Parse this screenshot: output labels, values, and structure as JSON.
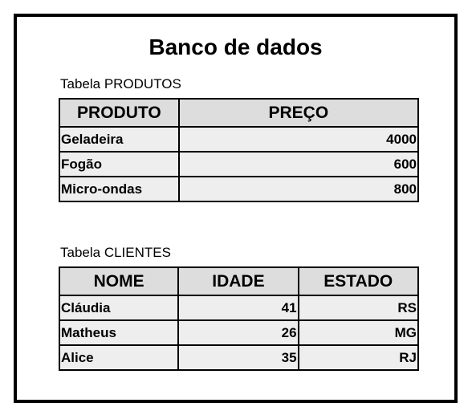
{
  "title": "Banco de dados",
  "produtos": {
    "caption": "Tabela PRODUTOS",
    "headers": [
      "PRODUTO",
      "PREÇO"
    ],
    "rows": [
      {
        "produto": "Geladeira",
        "preco": "4000"
      },
      {
        "produto": "Fogão",
        "preco": "600"
      },
      {
        "produto": "Micro-ondas",
        "preco": "800"
      }
    ]
  },
  "clientes": {
    "caption": "Tabela CLIENTES",
    "headers": [
      "NOME",
      "IDADE",
      "ESTADO"
    ],
    "rows": [
      {
        "nome": "Cláudia",
        "idade": "41",
        "estado": "RS"
      },
      {
        "nome": "Matheus",
        "idade": "26",
        "estado": "MG"
      },
      {
        "nome": "Alice",
        "idade": "35",
        "estado": "RJ"
      }
    ]
  }
}
